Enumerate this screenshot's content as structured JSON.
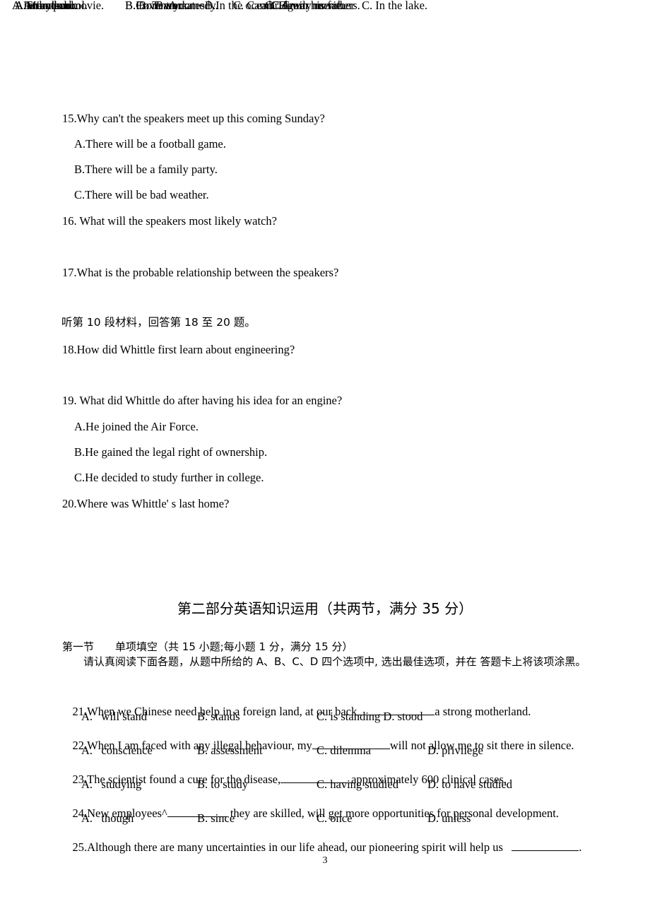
{
  "document": {
    "page_number": "3",
    "language": "zh-CN + en"
  },
  "listening_section": {
    "q14_options": [
      {
        "label": "A.In the pool."
      },
      {
        "label": "B.In the ocean."
      },
      {
        "label": "C. In the lake."
      }
    ],
    "questions": [
      {
        "number": "15",
        "stem": "15.Why can't the speakers meet up this coming Sunday?",
        "layout": "stacked",
        "options": [
          "A.There will be a football game.",
          "B.There will be a family party.",
          "C.There will be bad weather."
        ]
      },
      {
        "number": "16",
        "stem": "16. What will the speakers most likely watch?",
        "layout": "inline",
        "options": [
          "A.An action movie.",
          "B. A comedy.",
          "C.A war movie."
        ]
      },
      {
        "number": "17",
        "stem": "17.What is the probable relationship between the speakers?",
        "layout": "inline",
        "options": [
          "A.Friends.",
          "B. Teammates.",
          "C. Family members."
        ]
      }
    ],
    "material_notice": "听第 10 段材料，回答第 18 至 20 题。",
    "questions2": [
      {
        "number": "18",
        "stem": "18.How did Whittle first learn about engineering?",
        "layout": "inline",
        "options": [
          "A.From school.",
          "B.From work.",
          "C.From his father"
        ]
      },
      {
        "number": "19",
        "stem": "19. What did Whittle do after having his idea for an engine?",
        "layout": "stacked",
        "options": [
          "A.He joined the Air Force.",
          "B.He gained the legal right of ownership.",
          "C.He decided to study further in college."
        ]
      },
      {
        "number": "20",
        "stem": "20.Where was Whittle' s last home?",
        "layout": "inline",
        "options": [
          "A.Maryland.",
          "B.Coventry.",
          "C. Cambridge."
        ]
      }
    ]
  },
  "part_two": {
    "heading": "第二部分英语知识运用（共两节，满分 35 分）",
    "section_one_title": "第一节　　单项填空（共 15 小题;每小题 1 分，满分 15 分）",
    "section_one_directions": "　　请认真阅读下面各题，从题中所给的 A、B、C、D 四个选项中, 选出最佳选项，并在 答题卡上将该项涂黑。",
    "questions": [
      {
        "number": "21",
        "stem_before": "21.When we Chinese need help in a foreign land, at our back",
        "stem_after": "a strong motherland.",
        "blank_width": "b-110",
        "options": [
          "A.   will stand",
          "B. stands",
          "C. is standing D. stood"
        ],
        "option_count": 3
      },
      {
        "number": "22",
        "stem_before": "22.When I am faced with any illegal behaviour, my",
        "stem_after": "will not allow me to sit there in silence.",
        "blank_width": "b-110",
        "options": [
          "A.   conscience",
          "B. assessment",
          "C. dilemma",
          "D. privilege"
        ],
        "option_count": 4
      },
      {
        "number": "23",
        "stem_before": "23.The scientist found a cure for the disease,",
        "stem_after": "approximately 600 clinical cases.",
        "blank_width": "b-100",
        "options": [
          "A.   studying",
          "B. to study",
          "C. having studied",
          "D. to have studied"
        ],
        "option_count": 4
      },
      {
        "number": "24",
        "stem_before": "24.New employees^",
        "stem_after": " they are skilled, will get more opportunities for personal development.",
        "blank_width": "b-85",
        "options": [
          "A.   though",
          "B. since",
          "C. once",
          "D. unless"
        ],
        "option_count": 4
      },
      {
        "number": "25",
        "stem_before": "25.Although there are many uncertainties in our life ahead, our pioneering spirit will help us   ",
        "stem_after": ".",
        "blank_width": "b-95",
        "options": [],
        "option_count": 0
      }
    ]
  }
}
